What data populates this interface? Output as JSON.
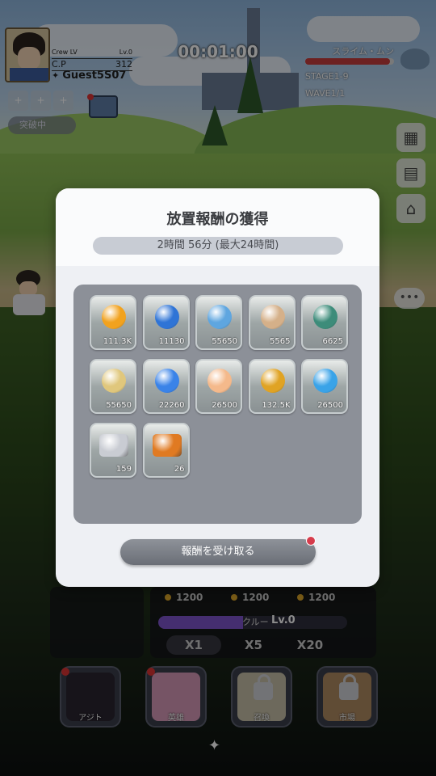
{
  "hud": {
    "crew_lv_label": "Crew LV",
    "crew_lv_value": "Lv.0",
    "cp_label": "C.P",
    "cp_value": "312",
    "player_name": "Guest5S07",
    "breakthrough_label": "突破中",
    "timer": "00:01:00",
    "boss_name": "スライム・ムン",
    "boss_hp_fraction": 0.95,
    "stage": "STAGE1-9",
    "wave": "WAVE1/1"
  },
  "modal": {
    "title": "放置報酬の獲得",
    "time_text": "2時間 56分 (最大24時間)",
    "claim_label": "報酬を受け取る",
    "items": [
      {
        "icon": "gold-coin-icon",
        "count": "111.3K",
        "color": "#f2a21e"
      },
      {
        "icon": "blue-orb-icon",
        "count": "11130",
        "color": "#2f74d6"
      },
      {
        "icon": "fish-icon",
        "count": "55650",
        "color": "#5fa6e0"
      },
      {
        "icon": "star-emblem-icon",
        "count": "5565",
        "color": "#d5b089"
      },
      {
        "icon": "world-orb-icon",
        "count": "6625",
        "color": "#3d8c7a"
      },
      {
        "icon": "compass-star-icon",
        "count": "55650",
        "color": "#e0c77c"
      },
      {
        "icon": "blue-crystal-icon",
        "count": "22260",
        "color": "#3a83e8"
      },
      {
        "icon": "peach-icon",
        "count": "26500",
        "color": "#f4b98b"
      },
      {
        "icon": "trophy-icon",
        "count": "132.5K",
        "color": "#e0a324"
      },
      {
        "icon": "blue-yarn-ball-icon",
        "count": "26500",
        "color": "#3aa3e8"
      },
      {
        "icon": "silver-chest-icon",
        "count": "159",
        "color": "#c9ccd3"
      },
      {
        "icon": "gold-chest-icon",
        "count": "26",
        "color": "#e07a22"
      }
    ]
  },
  "bottom": {
    "costs": [
      "1200",
      "1200",
      "1200"
    ],
    "crew_bar_label": "クルー",
    "crew_level": "Lv.0",
    "multipliers": [
      "X1",
      "X5",
      "X20"
    ],
    "menu": [
      {
        "label": "アジト",
        "locked": false
      },
      {
        "label": "英雄",
        "locked": false
      },
      {
        "label": "召喚",
        "locked": true
      },
      {
        "label": "市場",
        "locked": true
      }
    ]
  }
}
